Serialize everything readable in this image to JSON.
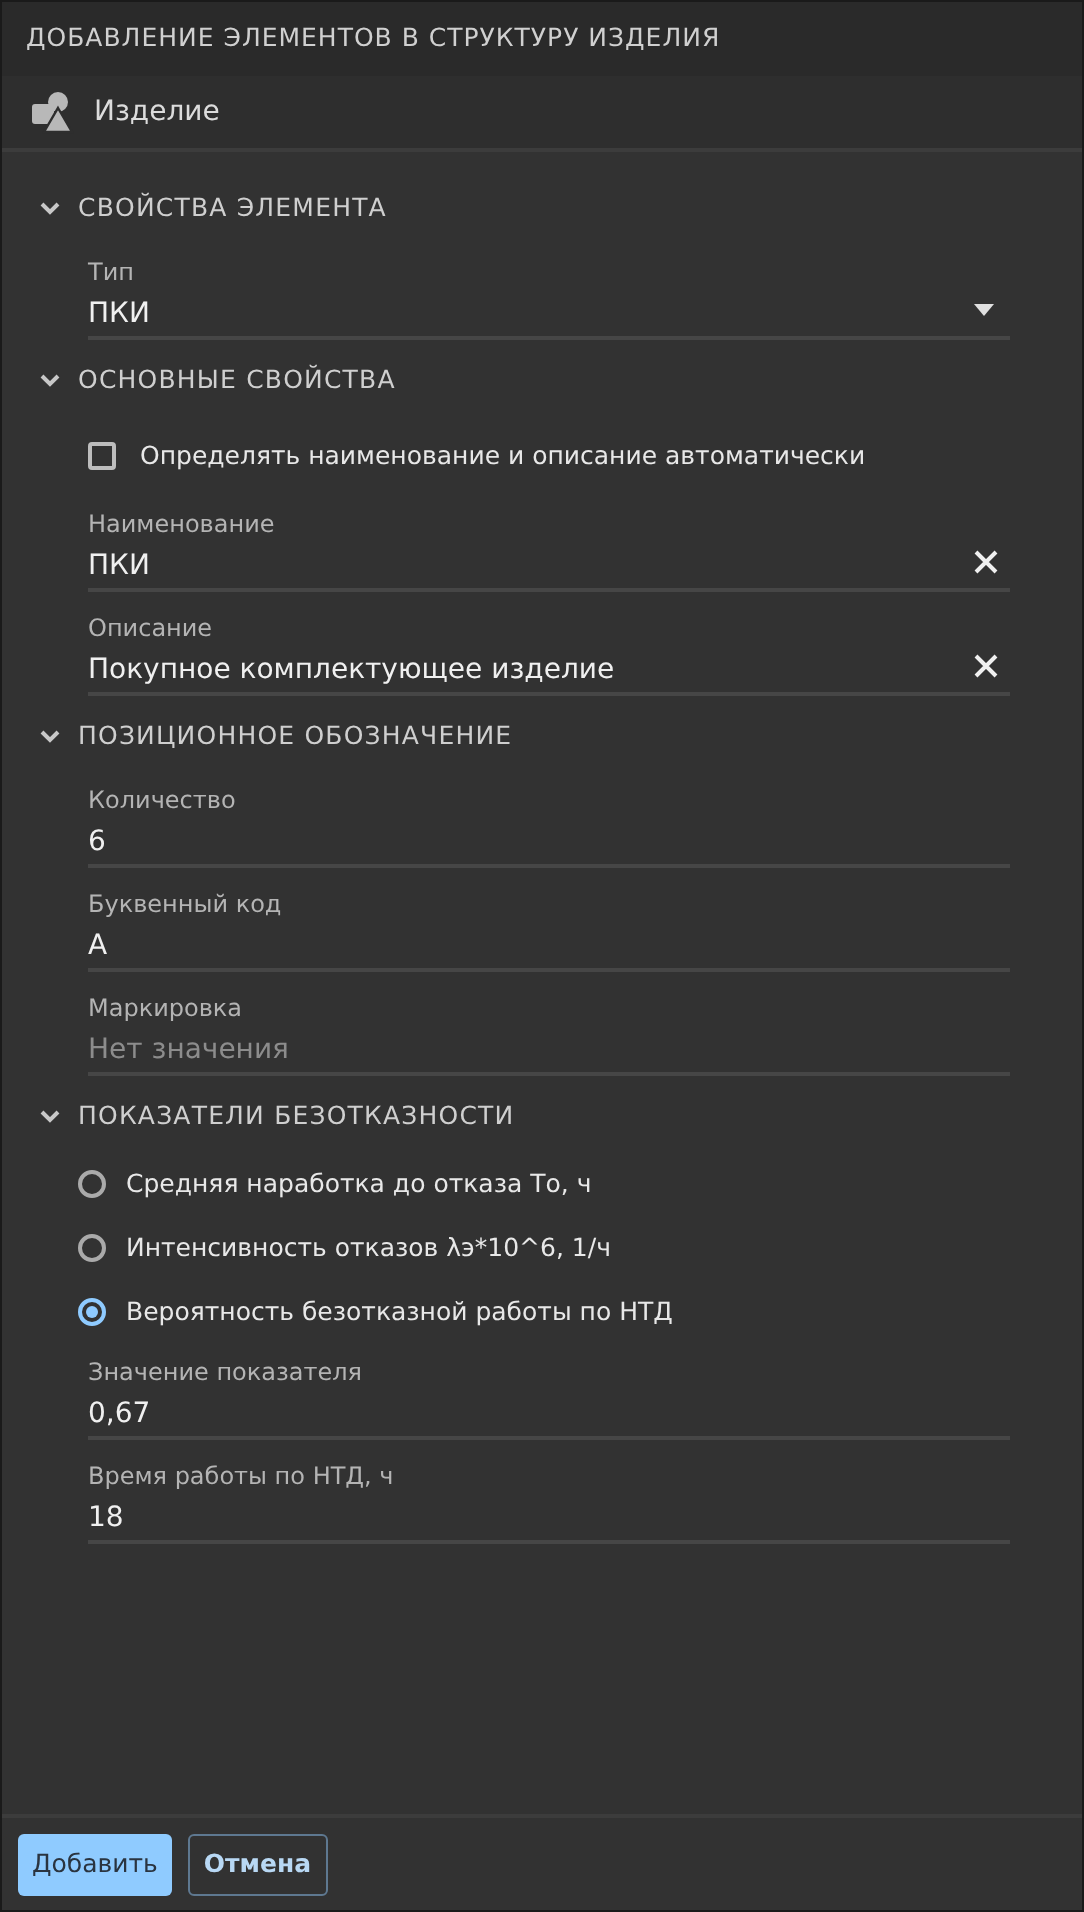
{
  "window": {
    "title": "ДОБАВЛЕНИЕ ЭЛЕМЕНТОВ В СТРУКТУРУ ИЗДЕЛИЯ"
  },
  "header": {
    "label": "Изделие"
  },
  "sections": [
    {
      "title": "СВОЙСТВА ЭЛЕМЕНТА",
      "expanded": true,
      "items": [
        {
          "kind": "select",
          "label": "Тип",
          "value": "ПКИ"
        }
      ]
    },
    {
      "title": "ОСНОВНЫЕ СВОЙСТВА",
      "expanded": true,
      "items": [
        {
          "kind": "checkbox",
          "label": "Определять наименование и описание автоматически",
          "checked": false
        },
        {
          "kind": "clearable",
          "label": "Наименование",
          "value": "ПКИ"
        },
        {
          "kind": "clearable",
          "label": "Описание",
          "value": "Покупное комплектующее изделие"
        }
      ]
    },
    {
      "title": "ПОЗИЦИОННОЕ ОБОЗНАЧЕНИЕ",
      "expanded": true,
      "items": [
        {
          "kind": "field",
          "label": "Количество",
          "value": "6"
        },
        {
          "kind": "field",
          "label": "Буквенный код",
          "value": "А"
        },
        {
          "kind": "field",
          "label": "Маркировка",
          "placeholder": "Нет значения"
        }
      ]
    },
    {
      "title": "ПОКАЗАТЕЛИ БЕЗОТКАЗНОСТИ",
      "expanded": true,
      "items": [
        {
          "kind": "radio",
          "label": "Средняя наработка до отказа То, ч",
          "selected": false
        },
        {
          "kind": "radio",
          "label": "Интенсивность отказов λэ*10^6, 1/ч",
          "selected": false
        },
        {
          "kind": "radio",
          "label": "Вероятность безотказной работы по НТД",
          "selected": true
        },
        {
          "kind": "field",
          "label": "Значение показателя",
          "value": "0,67"
        },
        {
          "kind": "field",
          "label": "Время работы по НТД, ч",
          "value": "18"
        }
      ]
    }
  ],
  "buttons": [
    {
      "label": "Добавить",
      "primary": true
    },
    {
      "label": "Отмена",
      "primary": false
    }
  ]
}
